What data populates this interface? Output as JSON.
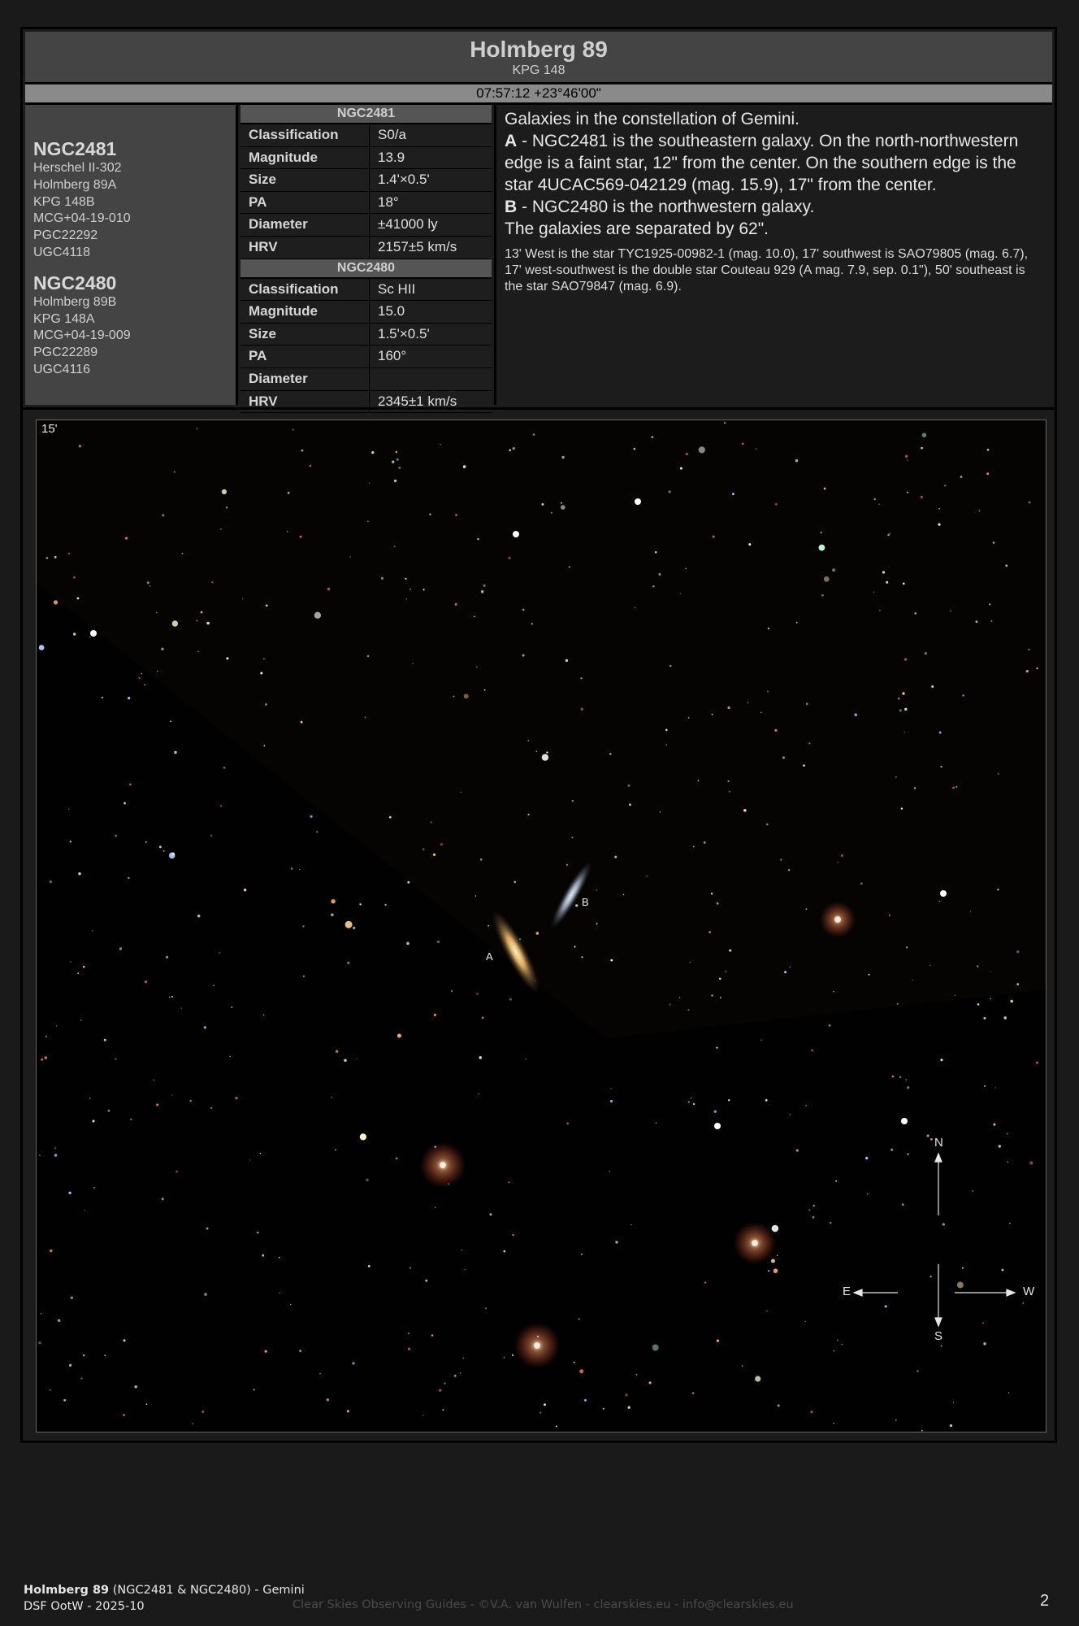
{
  "header": {
    "title": "Holmberg 89",
    "subtitle": "KPG 148",
    "coordinates": "07:57:12 +23°46'00\""
  },
  "galaxies": [
    {
      "name": "NGC2481",
      "aliases": [
        "Herschel II-302",
        "Holmberg 89A",
        "KPG 148B",
        "MCG+04-19-010",
        "PGC22292",
        "UGC4118"
      ],
      "table": [
        {
          "key": "Classification",
          "value": "S0/a"
        },
        {
          "key": "Magnitude",
          "value": "13.9"
        },
        {
          "key": "Size",
          "value": "1.4'×0.5'"
        },
        {
          "key": "PA",
          "value": "18°"
        },
        {
          "key": "Diameter",
          "value": "±41000 ly"
        },
        {
          "key": "HRV",
          "value": "2157±5 km/s"
        }
      ]
    },
    {
      "name": "NGC2480",
      "aliases": [
        "Holmberg 89B",
        "KPG 148A",
        "MCG+04-19-009",
        "PGC22289",
        "UGC4116"
      ],
      "table": [
        {
          "key": "Classification",
          "value": "Sc HII"
        },
        {
          "key": "Magnitude",
          "value": "15.0"
        },
        {
          "key": "Size",
          "value": "1.5'×0.5'"
        },
        {
          "key": "PA",
          "value": "160°"
        },
        {
          "key": "Diameter",
          "value": ""
        },
        {
          "key": "HRV",
          "value": "2345±1 km/s"
        }
      ]
    }
  ],
  "description": {
    "intro": "Galaxies in the constellation of Gemini.",
    "a_label": "A",
    "a_text": " - NGC2481 is the southeastern galaxy. On the north-northwestern edge is a faint star, 12\" from the center. On the southern edge is the star 4UCAC569-042129 (mag. 15.9), 17\" from the center.",
    "b_label": "B",
    "b_text": " - NGC2480 is the northwestern galaxy.",
    "separation": "The galaxies are separated by 62\".",
    "surroundings": "13' West is the star TYC1925-00982-1 (mag. 10.0), 17' southwest is SAO79805 (mag. 6.7), 17' west-southwest is the double star Couteau 929 (A mag. 7.9, sep. 0.1\"), 50' southeast is the star SAO79847 (mag. 6.9)."
  },
  "image": {
    "fov_label": "15'",
    "label_a": "A",
    "label_b": "B",
    "compass": {
      "n": "N",
      "s": "S",
      "e": "E",
      "w": "W"
    }
  },
  "footer": {
    "title_bold": "Holmberg 89",
    "title_rest": " (NGC2481 & NGC2480) - Gemini",
    "series": "DSF OotW - 2025-10",
    "credit": "Clear Skies Observing Guides - ©V.A. van Wulfen - clearskies.eu - info@clearskies.eu",
    "page": "2"
  }
}
